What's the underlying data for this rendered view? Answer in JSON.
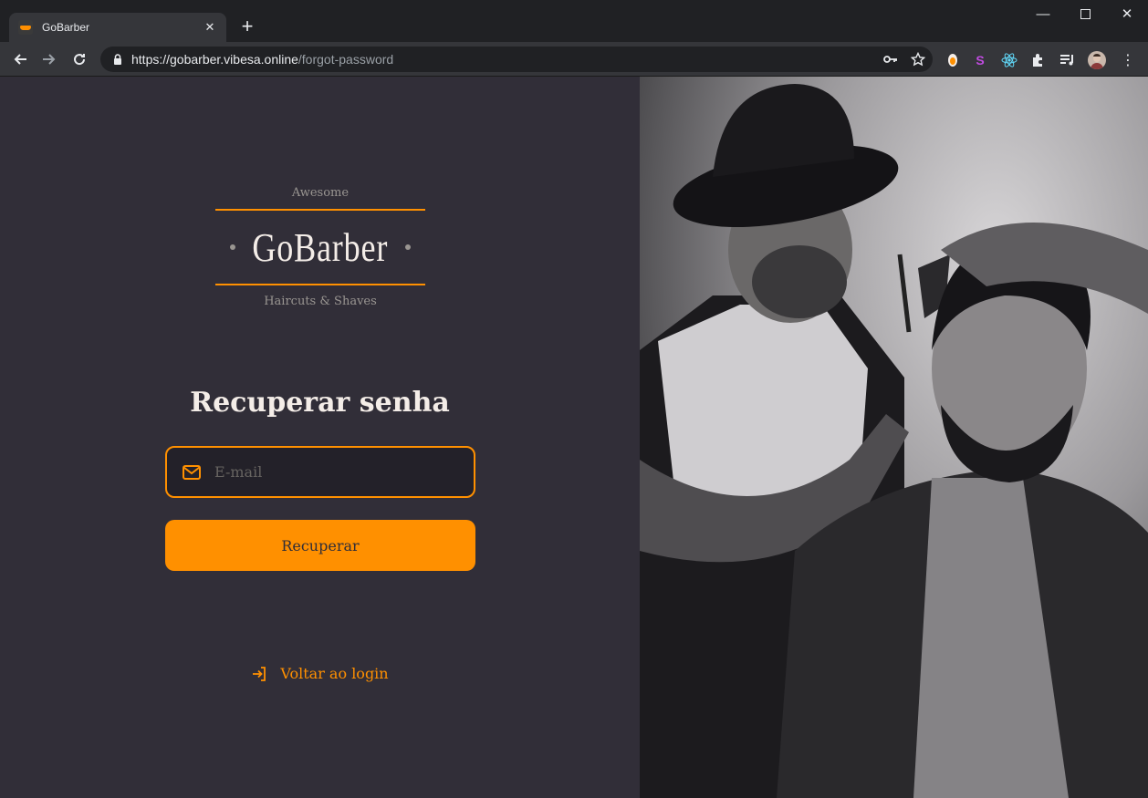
{
  "browser": {
    "tab_title": "GoBarber",
    "url_host": "https://gobarber.vibesa.online",
    "url_path": "/forgot-password",
    "extensions": [
      "key-icon",
      "star-icon",
      "extension-orange",
      "extension-s",
      "react-icon",
      "puzzle-icon",
      "playlist-icon",
      "avatar"
    ]
  },
  "logo": {
    "top": "Awesome",
    "main": "GoBarber",
    "bottom": "Haircuts & Shaves"
  },
  "form": {
    "title": "Recuperar senha",
    "email_placeholder": "E-mail",
    "email_value": "",
    "submit_label": "Recuperar"
  },
  "back_link": {
    "label": "Voltar ao login"
  },
  "colors": {
    "background": "#312e38",
    "accent": "#ff9000",
    "input_bg": "#232129",
    "text": "#f4ede8",
    "muted": "#999591"
  }
}
